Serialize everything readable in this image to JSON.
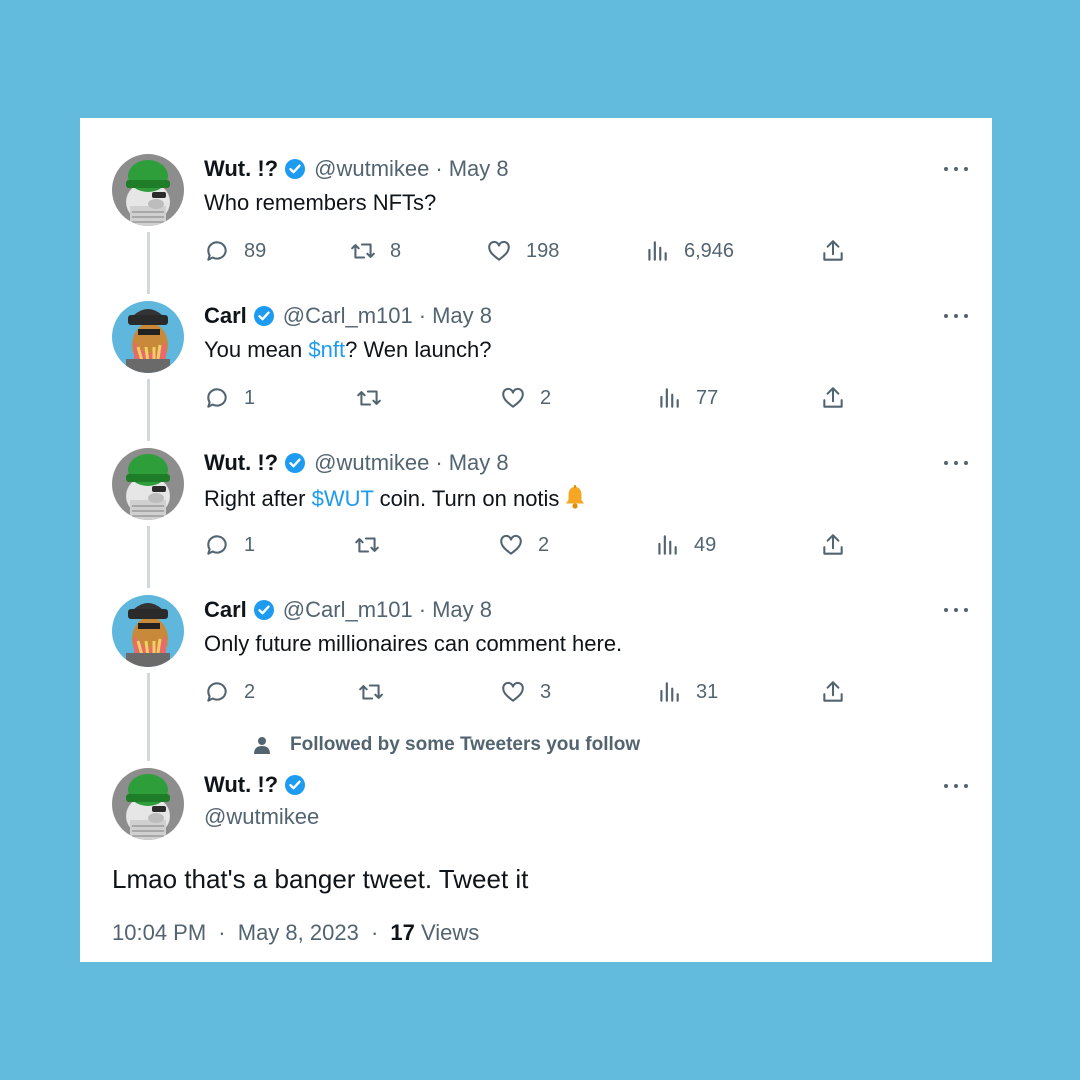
{
  "tweets": [
    {
      "name": "Wut. !?",
      "handle": "@wutmikee",
      "date": "May 8",
      "text_before": "Who remembers NFTs?",
      "cashtag": "",
      "text_after": "",
      "avatar": "green-hat-ape-avatar",
      "replies": "89",
      "retweets": "8",
      "likes": "198",
      "views": "6,946"
    },
    {
      "name": "Carl",
      "handle": "@Carl_m101",
      "date": "May 8",
      "text_before": "You mean ",
      "cashtag": "$nft",
      "text_after": "? Wen launch?",
      "avatar": "pirate-ape-avatar",
      "replies": "1",
      "retweets": "",
      "likes": "2",
      "views": "77"
    },
    {
      "name": "Wut. !?",
      "handle": "@wutmikee",
      "date": "May 8",
      "text_before": "Right after ",
      "cashtag": "$WUT",
      "text_after": " coin. Turn on notis",
      "avatar": "green-hat-ape-avatar",
      "replies": "1",
      "retweets": "",
      "likes": "2",
      "views": "49"
    },
    {
      "name": "Carl",
      "handle": "@Carl_m101",
      "date": "May 8",
      "text_before": "Only future millionaires can comment here.",
      "cashtag": "",
      "text_after": "",
      "avatar": "pirate-ape-avatar",
      "replies": "2",
      "retweets": "",
      "likes": "3",
      "views": "31"
    }
  ],
  "followed_note": "Followed by some Tweeters you follow",
  "main_tweet": {
    "name": "Wut. !?",
    "handle": "@wutmikee",
    "text": "Lmao that's a banger tweet. Tweet it",
    "time": "10:04 PM",
    "date": "May 8, 2023",
    "views_count": "17",
    "views_label": "Views"
  },
  "separator": "·",
  "colors": {
    "background": "#62bbdd",
    "link": "#1d9bf0",
    "verified": "#1d9bf0",
    "muted": "#536471"
  }
}
